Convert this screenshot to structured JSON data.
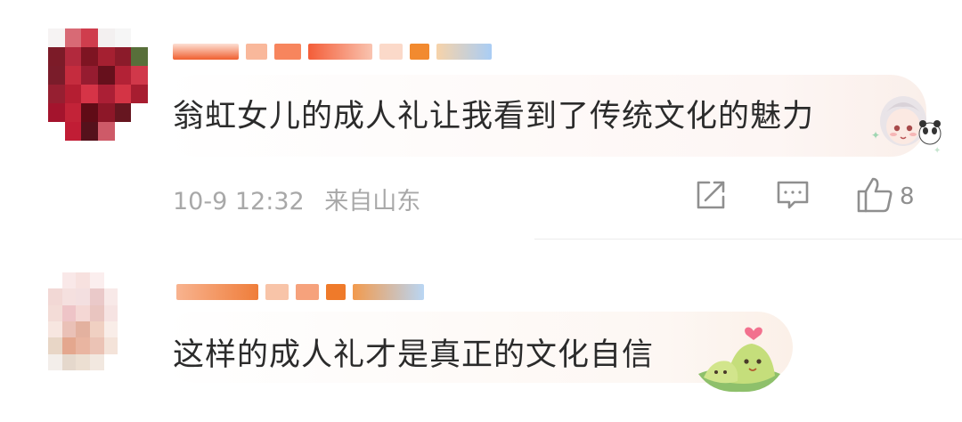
{
  "comments": [
    {
      "text": "翁虹女儿的成人礼让我看到了传统文化的魅力",
      "time": "10-9 12:32",
      "location": "来自山东",
      "like_count": "8"
    },
    {
      "text": "这样的成人礼才是真正的文化自信"
    }
  ],
  "icons": {
    "share": "share-icon",
    "reply": "reply-icon",
    "like": "thumbs-up-icon"
  },
  "colors": {
    "text": "#2b2b2b",
    "meta": "#a8a8a8",
    "icon": "#8f8f8f"
  }
}
